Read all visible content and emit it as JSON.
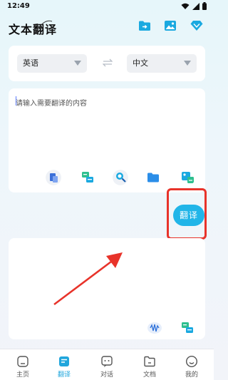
{
  "status": {
    "time": "12:49"
  },
  "header": {
    "title": "文本翻译",
    "icons": [
      "folder-export-icon",
      "image-icon",
      "diamond-icon"
    ]
  },
  "language_bar": {
    "source_language": "英语",
    "target_language": "中文",
    "swap_icon": "swap-arrows-icon"
  },
  "input": {
    "placeholder": "请输入需要翻译的内容",
    "tools": [
      "translate-doc-icon",
      "chat-icon",
      "scan-search-icon",
      "folder-icon",
      "image-translate-icon"
    ]
  },
  "translate_button": {
    "label": "翻译"
  },
  "output": {
    "tools": [
      "voice-wave-icon",
      "chat-icon"
    ]
  },
  "tabbar": {
    "items": [
      {
        "label": "主页",
        "icon": "home-icon",
        "active": false
      },
      {
        "label": "翻译",
        "icon": "translate-tab-icon",
        "active": true
      },
      {
        "label": "对话",
        "icon": "dialog-icon",
        "active": false
      },
      {
        "label": "文档",
        "icon": "document-icon",
        "active": false
      },
      {
        "label": "我的",
        "icon": "profile-icon",
        "active": false
      }
    ]
  },
  "colors": {
    "accent": "#21b5e8",
    "highlight_box": "#e8332a",
    "annotation_arrow": "#e8332a"
  }
}
